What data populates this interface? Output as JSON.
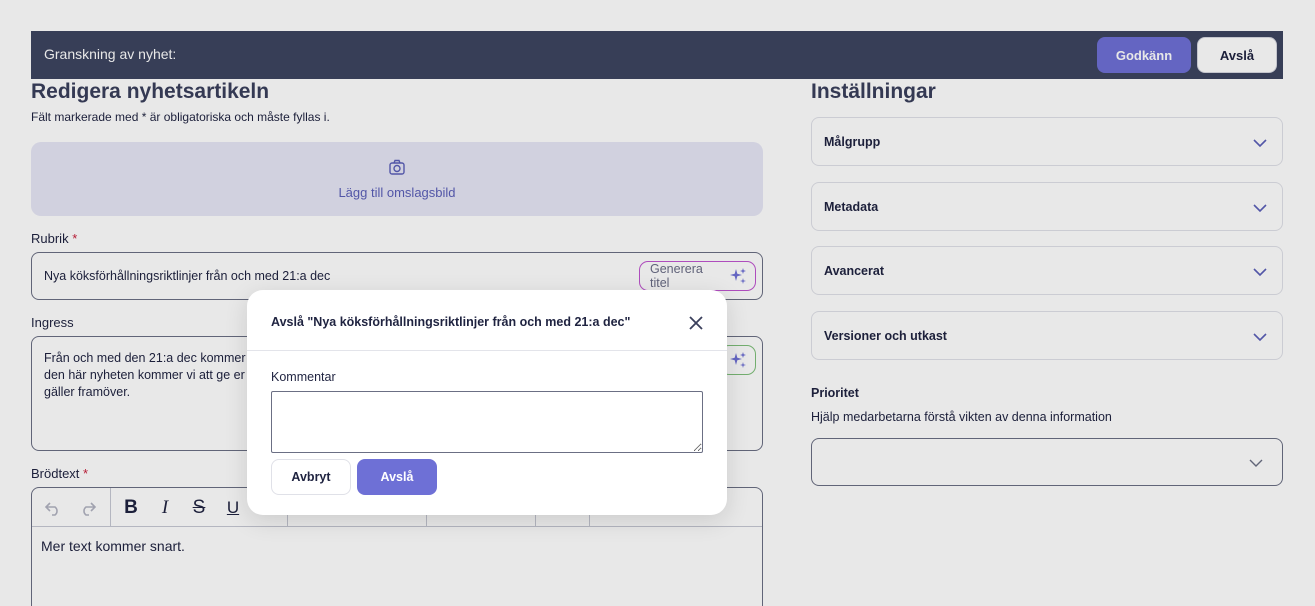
{
  "header": {
    "title": "Granskning av nyhet:",
    "approve_label": "Godkänn",
    "reject_label": "Avslå"
  },
  "editor_panel": {
    "heading": "Redigera nyhetsartikeln",
    "required_hint": "Fält markerade med * är obligatoriska och måste fyllas i.",
    "cover_image_label": "Lägg till omslagsbild",
    "rubrik": {
      "label": "Rubrik",
      "required_mark": "*",
      "value": "Nya köksförhållningsriktlinjer från och med 21:a dec",
      "ai_button_label": "Generera titel"
    },
    "ingress": {
      "label": "Ingress",
      "lines": [
        "Från och med den 21:a dec kommer",
        "den här nyheten kommer vi att ge er",
        "gäller framöver."
      ]
    },
    "brodtext": {
      "label": "Brödtext",
      "required_mark": "*",
      "body": "Mer text kommer snart."
    }
  },
  "settings_panel": {
    "heading": "Inställningar",
    "accordions": [
      {
        "label": "Målgrupp"
      },
      {
        "label": "Metadata"
      },
      {
        "label": "Avancerat"
      },
      {
        "label": "Versioner och utkast"
      }
    ],
    "priority": {
      "label": "Prioritet",
      "help": "Hjälp medarbetarna förstå vikten av denna information",
      "selected": ""
    }
  },
  "modal": {
    "title": "Avslå \"Nya köksförhållningsriktlinjer från och med 21:a dec\"",
    "comment_label": "Kommentar",
    "comment_value": "",
    "cancel_label": "Avbryt",
    "confirm_label": "Avslå"
  },
  "colors": {
    "header_bg": "#3d4560",
    "accent": "#6e70d6",
    "required": "#c81e3a"
  }
}
